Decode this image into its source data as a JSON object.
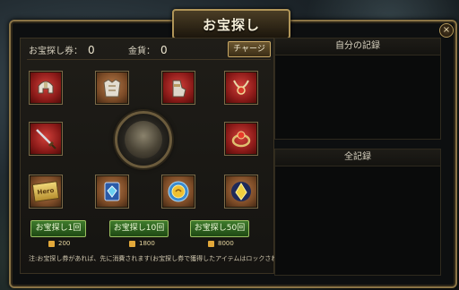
{
  "window": {
    "title": "お宝探し",
    "close": "×"
  },
  "stats": {
    "ticket_label": "お宝探し券：",
    "ticket_value": "0",
    "gold_label": "金貨：",
    "gold_value": "0",
    "charge_label": "チャージ"
  },
  "slots": [
    {
      "name": "slot-helmet",
      "icon": "helmet-icon",
      "color": "red"
    },
    {
      "name": "slot-armor",
      "icon": "armor-icon",
      "color": "brown"
    },
    {
      "name": "slot-gauntlet",
      "icon": "gauntlet-icon",
      "color": "red"
    },
    {
      "name": "slot-necklace",
      "icon": "necklace-icon",
      "color": "red"
    },
    {
      "name": "slot-sword",
      "icon": "sword-icon",
      "color": "red"
    },
    {
      "name": "slot-ring",
      "icon": "ring-icon",
      "color": "red"
    },
    {
      "name": "slot-hero-card",
      "icon": "hero-card-icon",
      "color": "brown"
    },
    {
      "name": "slot-gem-card",
      "icon": "gem-card-icon",
      "color": "brown"
    },
    {
      "name": "slot-gold-orb",
      "icon": "gold-orb-icon",
      "color": "brown"
    },
    {
      "name": "slot-crystal",
      "icon": "crystal-icon",
      "color": "brown"
    }
  ],
  "slot_card_text": "Hero",
  "draw_buttons": [
    {
      "label": "お宝探し1回",
      "cost": "200"
    },
    {
      "label": "お宝探し10回",
      "cost": "1800"
    },
    {
      "label": "お宝探し50回",
      "cost": "8000"
    }
  ],
  "note": "注:お宝探し券があれば、先に消費されます(お宝探し券で獲得したアイテムはロックされます)",
  "records": {
    "own_title": "自分の記録",
    "all_title": "全記録"
  }
}
